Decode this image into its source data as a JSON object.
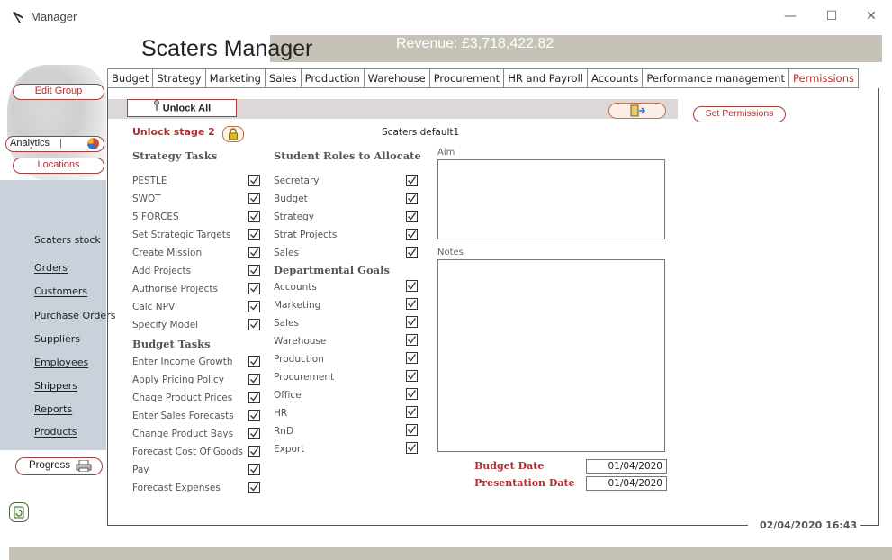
{
  "window": {
    "title": "Manager",
    "minimize": "—",
    "maximize": "☐",
    "close": "✕"
  },
  "header": {
    "app_name": "Scaters Manager",
    "revenue": "Revenue: £3,718,422.82"
  },
  "tabs": [
    {
      "label": "Budget"
    },
    {
      "label": "Strategy"
    },
    {
      "label": "Marketing"
    },
    {
      "label": "Sales"
    },
    {
      "label": "Production"
    },
    {
      "label": "Warehouse"
    },
    {
      "label": "Procurement"
    },
    {
      "label": "HR and Payroll"
    },
    {
      "label": "Accounts"
    },
    {
      "label": "Performance management"
    },
    {
      "label": "Permissions",
      "active": true
    }
  ],
  "sidebar": {
    "edit_group": "Edit Group",
    "analytics": "Analytics",
    "locations": "Locations",
    "links": [
      "Scaters stock",
      "Orders",
      "Customers",
      "Purchase Orders",
      "Suppliers",
      "Employees",
      "Shippers",
      "Reports",
      "Products"
    ],
    "progress": "Progress"
  },
  "toolbar": {
    "unlock_all": "Unlock All",
    "set_permissions": "Set Permissions",
    "exit_icon": "door-exit-icon"
  },
  "unlock_stage": "Unlock stage 2",
  "default_name": "Scaters default1",
  "strategy_tasks": {
    "heading": "Strategy Tasks",
    "items": [
      {
        "label": "PESTLE",
        "checked": true
      },
      {
        "label": "SWOT",
        "checked": true
      },
      {
        "label": "5 FORCES",
        "checked": true
      },
      {
        "label": "Set Strategic Targets",
        "checked": true
      },
      {
        "label": "Create Mission",
        "checked": true
      },
      {
        "label": "Add Projects",
        "checked": true
      },
      {
        "label": "Authorise Projects",
        "checked": true
      },
      {
        "label": "Calc NPV",
        "checked": true
      },
      {
        "label": "Specify Model",
        "checked": true
      }
    ]
  },
  "budget_tasks": {
    "heading": "Budget Tasks",
    "items": [
      {
        "label": "Enter Income Growth",
        "checked": true
      },
      {
        "label": "Apply Pricing Policy",
        "checked": true
      },
      {
        "label": "Chage Product Prices",
        "checked": true
      },
      {
        "label": "Enter Sales Forecasts",
        "checked": true
      },
      {
        "label": "Change Product Bays",
        "checked": true
      },
      {
        "label": "Forecast Cost Of Goods",
        "checked": true
      },
      {
        "label": "Pay",
        "checked": true
      },
      {
        "label": "Forecast Expenses",
        "checked": true
      }
    ]
  },
  "student_roles": {
    "heading": "Student Roles to Allocate",
    "items": [
      {
        "label": "Secretary",
        "checked": true
      },
      {
        "label": "Budget",
        "checked": true
      },
      {
        "label": "Strategy",
        "checked": true
      },
      {
        "label": "Strat Projects",
        "checked": true
      },
      {
        "label": "Sales",
        "checked": true
      }
    ]
  },
  "departmental_goals": {
    "heading": "Departmental Goals",
    "items": [
      {
        "label": "Accounts",
        "checked": true
      },
      {
        "label": "Marketing",
        "checked": true
      },
      {
        "label": "Sales",
        "checked": true
      },
      {
        "label": "Warehouse",
        "checked": true
      },
      {
        "label": "Production",
        "checked": true
      },
      {
        "label": "Procurement",
        "checked": true
      },
      {
        "label": "Office",
        "checked": true
      },
      {
        "label": "HR",
        "checked": true
      },
      {
        "label": "RnD",
        "checked": true
      },
      {
        "label": "Export",
        "checked": true
      }
    ]
  },
  "aim": {
    "label": "Aim",
    "value": ""
  },
  "notes": {
    "label": "Notes",
    "value": ""
  },
  "budget_date": {
    "label": "Budget Date",
    "value": "01/04/2020"
  },
  "presentation_date": {
    "label": "Presentation Date",
    "value": "01/04/2020"
  },
  "datetime": "02/04/2020 16:43"
}
